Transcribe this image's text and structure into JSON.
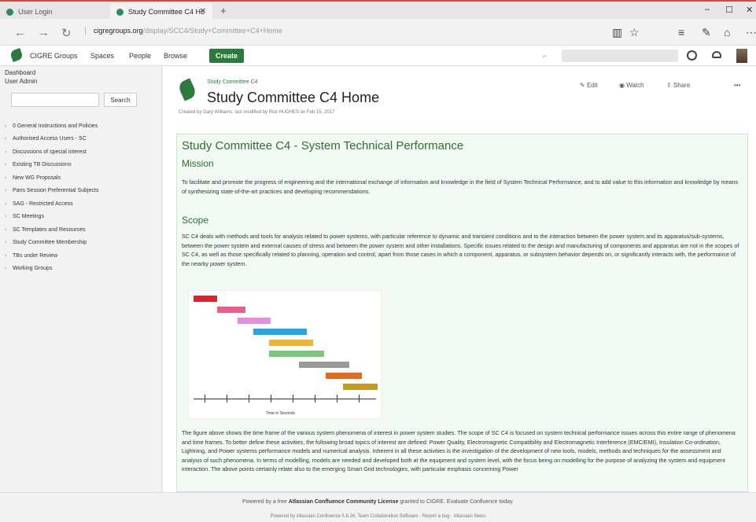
{
  "browser": {
    "tabs": [
      {
        "label": "User Login"
      },
      {
        "label": "Study Committee C4 Ho"
      }
    ],
    "new_tab": "+",
    "url_domain": "cigregroups.org",
    "url_path": "/display/SCC4/Study+Committee+C4+Home"
  },
  "app_nav": {
    "items": [
      "CIGRE Groups",
      "Spaces",
      "People",
      "Browse"
    ],
    "create_label": "Create"
  },
  "sidebar": {
    "top_links": [
      "Dashboard",
      "User Admin"
    ],
    "search_button": "Search",
    "tree": [
      "0 General Instructions and Policies",
      "Authorised Access Users - SC",
      "Discussions of special interest",
      "Existing TB Discussions",
      "New WG Proposals",
      "Paris Session Preferential Subjects",
      "SAG - Restricted Access",
      "SC Meetings",
      "SC Templates and Resources",
      "Study Committee Membership",
      "TBs under Review",
      "Working Groups"
    ]
  },
  "page": {
    "breadcrumb": "Study Committee C4",
    "title": "Study Committee C4 Home",
    "meta": "Created by Gary Williams, last modified by Rod HUGHES on Feb 15, 2017",
    "actions": {
      "edit": "Edit",
      "watch": "Watch",
      "share": "Share",
      "more": "•••"
    },
    "heading": "Study Committee C4 - System Technical Performance",
    "mission_title": "Mission",
    "mission_text": "To facilitate and promote the progress of engineering and the international exchange of information and knowledge in the field of System Technical Performance, and to add value to this information and knowledge by means of synthesizing state-of-the-art practices and developing recommendations.",
    "scope_title": "Scope",
    "scope_text": "SC C4 deals with methods and tools for analysis related to power systems, with particular reference to dynamic and transient conditions and to the interaction between the power system and its apparatus/sub-systems, between the power system and external causes of stress and between the power system and other installations. Specific issues related to the design and manufacturing of components and apparatus are not in the scopes of SC C4, as well as those specifically related to planning, operation and control, apart from those cases in which a component, apparatus, or subsystem behavior depends on, or significantly interacts with, the performance of the nearby power system.",
    "figure_axis_label": "Time in Seconds",
    "figure_text": "The figure above shows the time frame of the various system phenomena of interest in power system studies. The scope of SC C4 is focused on system technical performance issues across this entire range of phenomena and time frames. To better define these activities, the following broad topics of interest are defined: Power Quality, Electromagnetic Compatibility and Electromagnetic Interference (EMC/EMI), Insulation Co-ordination, Lightning, and Power systems performance models and numerical analysis. Inherent in all these activities is the investigation of the development of new tools, models, methods and techniques for the assessment and analysis of such phenomena. In terms of modelling, models are needed and developed both at the equipment and system level, with the focus being on modelling for the purpose of analyzing the system and equipment interaction. The above points certainly relate also to the emerging Smart Grid technologies, with particular emphasis concerning Power"
  },
  "figure_bars": [
    {
      "color": "#d9262a"
    },
    {
      "color": "#e8608a"
    },
    {
      "color": "#e58ee0"
    },
    {
      "color": "#29a6e0"
    },
    {
      "color": "#f2b233"
    },
    {
      "color": "#7dc67e"
    },
    {
      "color": "#9a9a9a"
    },
    {
      "color": "#e06a22"
    },
    {
      "color": "#c59a22"
    }
  ],
  "footer": {
    "line1_prefix": "Powered by a free",
    "line1_bold": "Atlassian Confluence Community License",
    "line1_suffix": "granted to CIGRE. Evaluate Confluence today.",
    "line2": "Powered by Atlassian Confluence 5.8.16, Team Collaboration Software · Report a bug · Atlassian News"
  }
}
